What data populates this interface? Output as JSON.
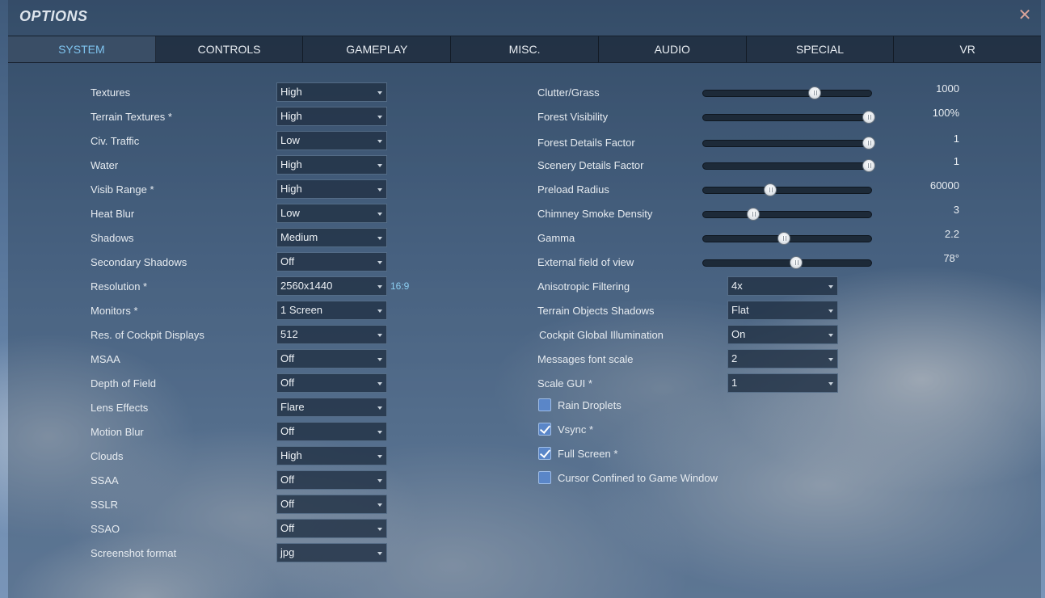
{
  "window": {
    "title": "OPTIONS",
    "close_glyph": "✕"
  },
  "tabs": [
    "SYSTEM",
    "CONTROLS",
    "GAMEPLAY",
    "MISC.",
    "AUDIO",
    "SPECIAL",
    "VR"
  ],
  "active_tab": "SYSTEM",
  "left_settings": [
    {
      "label": "Textures",
      "value": "High"
    },
    {
      "label": "Terrain Textures *",
      "value": "High"
    },
    {
      "label": "Civ. Traffic",
      "value": "Low"
    },
    {
      "label": "Water",
      "value": "High"
    },
    {
      "label": "Visib Range *",
      "value": "High"
    },
    {
      "label": "Heat Blur",
      "value": "Low"
    },
    {
      "label": "Shadows",
      "value": "Medium"
    },
    {
      "label": "Secondary Shadows",
      "value": "Off"
    },
    {
      "label": "Resolution *",
      "value": "2560x1440"
    },
    {
      "label": "Monitors *",
      "value": "1 Screen"
    },
    {
      "label": "Res. of Cockpit Displays",
      "value": "512"
    },
    {
      "label": "MSAA",
      "value": "Off"
    },
    {
      "label": "Depth of Field",
      "value": "Off"
    },
    {
      "label": "Lens Effects",
      "value": "Flare"
    },
    {
      "label": "Motion Blur",
      "value": "Off"
    },
    {
      "label": "Clouds",
      "value": "High"
    },
    {
      "label": "SSAA",
      "value": "Off"
    },
    {
      "label": "SSLR",
      "value": "Off"
    },
    {
      "label": "SSAO",
      "value": "Off"
    },
    {
      "label": "Screenshot format",
      "value": "jpg"
    }
  ],
  "resolution_aspect": "16:9",
  "sliders": [
    {
      "label": "Clutter/Grass",
      "value": "1000",
      "level": 0.66
    },
    {
      "label": "Forest Visibility",
      "value": "100%",
      "level": 0.98
    },
    {
      "label": "Forest Details Factor",
      "value": "1",
      "level": 0.98
    },
    {
      "label": "Scenery Details Factor",
      "value": "1",
      "level": 0.98
    },
    {
      "label": "Preload Radius",
      "value": "60000",
      "level": 0.4
    },
    {
      "label": "Chimney Smoke Density",
      "value": "3",
      "level": 0.3
    },
    {
      "label": "Gamma",
      "value": "2.2",
      "level": 0.48
    },
    {
      "label": "External field of view",
      "value": "78°",
      "level": 0.55
    }
  ],
  "right_dropdowns": [
    {
      "label": "Anisotropic Filtering",
      "value": "4x"
    },
    {
      "label": "Terrain Objects Shadows",
      "value": "Flat"
    },
    {
      "label": "Cockpit Global Illumination",
      "value": "On"
    },
    {
      "label": "Messages font scale",
      "value": "2"
    },
    {
      "label": "Scale GUI *",
      "value": "1"
    }
  ],
  "checkboxes": [
    {
      "label": "Rain Droplets",
      "checked": false
    },
    {
      "label": "Vsync *",
      "checked": true
    },
    {
      "label": "Full Screen *",
      "checked": true
    },
    {
      "label": "Cursor Confined to Game Window",
      "checked": false
    }
  ]
}
